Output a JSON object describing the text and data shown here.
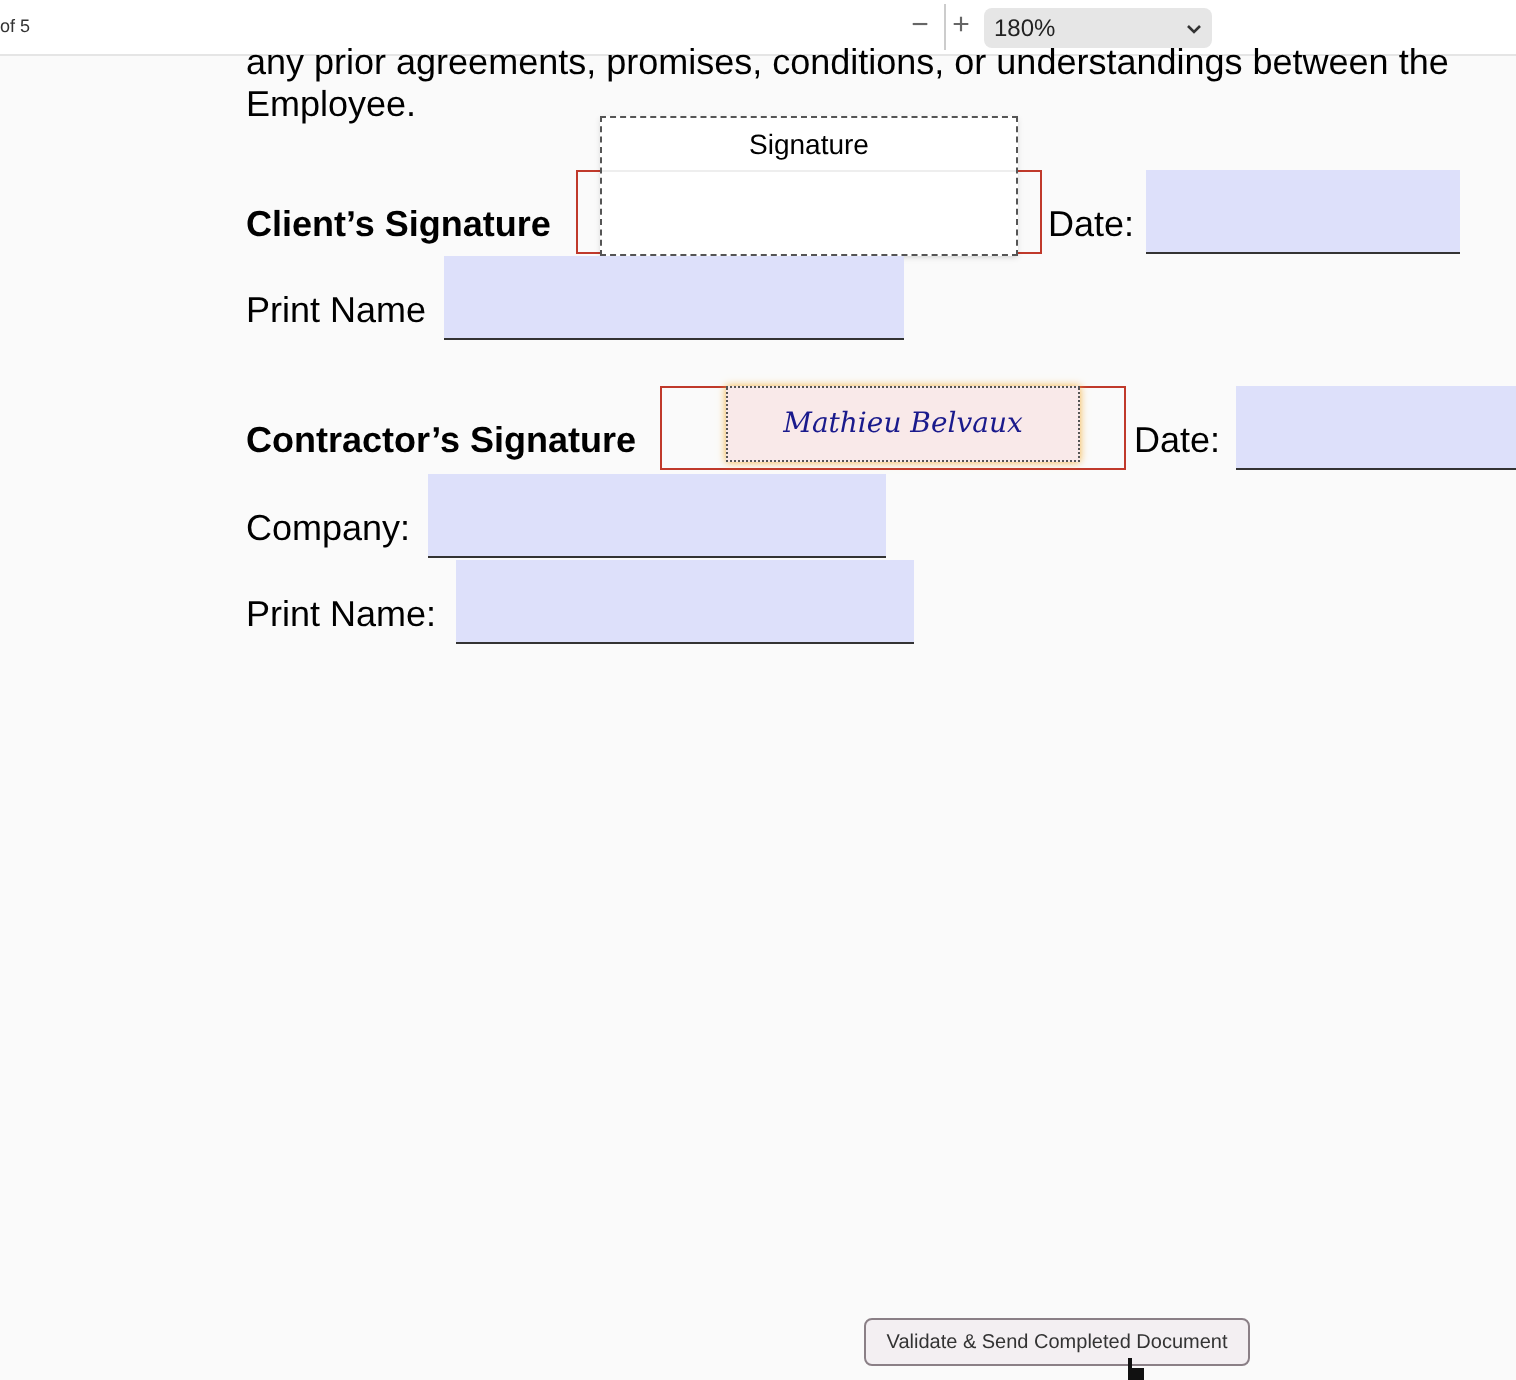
{
  "toolbar": {
    "page_indicator": "of 5",
    "zoom_out": "−",
    "zoom_in": "+",
    "zoom": "180%"
  },
  "paragraph": [
    "any prior agreements, promises, conditions, or understandings between the",
    "Employee."
  ],
  "client": {
    "signature_label": "Client’s Signature",
    "signature_popup": "Signature",
    "date_label": "Date:",
    "print_name_label": "Print Name"
  },
  "contractor": {
    "signature_label": "Contractor’s Signature",
    "signature": "Mathieu Belvaux",
    "date_label": "Date:",
    "company_label": "Company:",
    "print_name_label": "Print Name:"
  },
  "submit_button": "Validate & Send Completed Document"
}
